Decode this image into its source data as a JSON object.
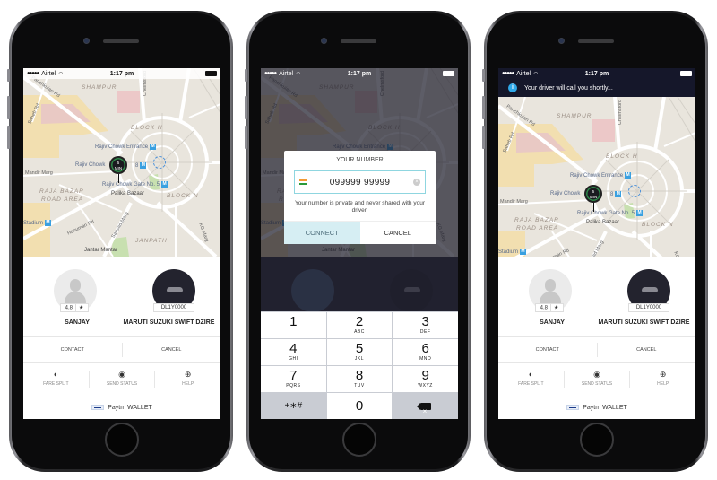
{
  "status_bar": {
    "carrier": "Airtel",
    "time": "1:17 pm"
  },
  "map": {
    "labels": {
      "shampur": "SHAMPUR",
      "block_h": "BLOCK H",
      "block_n": "BLOCK N",
      "raja_bazar_1": "RAJA BAZAR",
      "raja_bazar_2": "ROAD AREA",
      "janpath": "JANPATH",
      "rajiv_entrance": "Rajiv Chowk Entrance",
      "rajiv_chowk": "Rajiv Chowk",
      "rajiv_8": "8",
      "rajiv_gate5": "Rajiv Chowk Gate No. 5",
      "palika": "Palika Bazaar",
      "stadium": "Stadium",
      "mandir_marg": "Mandir Marg",
      "hanuman_rd": "Hanuman Rd",
      "sansad_marg": "Sansad Marg",
      "kg_marg": "KG Marg",
      "jantar_mantar": "Jantar Mantar",
      "chelmsford": "Chelmsford",
      "saheb_rd": "Saheb Rd",
      "panchkuian": "Panchkuian Rd"
    },
    "eta_pin": {
      "value": "5",
      "unit": "MIN"
    },
    "metro_glyph": "M"
  },
  "driver": {
    "name": "SANJAY",
    "rating": "4.8",
    "rating_icon": "★",
    "car": "MARUTI SUZUKI SWIFT DZIRE",
    "plate": "DL1Y0000"
  },
  "actions": {
    "contact": "CONTACT",
    "cancel": "CANCEL"
  },
  "tools": [
    {
      "label": "FARE SPLIT",
      "icon": "fare-split-icon",
      "glyph": "◐"
    },
    {
      "label": "SEND STATUS",
      "icon": "send-status-icon",
      "glyph": "◉"
    },
    {
      "label": "HELP",
      "icon": "help-icon",
      "glyph": "⊕"
    }
  ],
  "wallet": {
    "label": "Paytm WALLET"
  },
  "dialog": {
    "title": "YOUR NUMBER",
    "phone_value": "099999 99999",
    "clear_glyph": "×",
    "note": "Your number is private and never shared with your driver.",
    "connect": "CONNECT",
    "cancel": "CANCEL"
  },
  "keypad": [
    {
      "digit": "1",
      "letters": ""
    },
    {
      "digit": "2",
      "letters": "ABC"
    },
    {
      "digit": "3",
      "letters": "DEF"
    },
    {
      "digit": "4",
      "letters": "GHI"
    },
    {
      "digit": "5",
      "letters": "JKL"
    },
    {
      "digit": "6",
      "letters": "MNO"
    },
    {
      "digit": "7",
      "letters": "PQRS"
    },
    {
      "digit": "8",
      "letters": "TUV"
    },
    {
      "digit": "9",
      "letters": "WXYZ"
    },
    {
      "digit": "+∗#",
      "letters": ""
    },
    {
      "digit": "0",
      "letters": ""
    }
  ],
  "notification": {
    "icon_glyph": "i",
    "text": "Your driver will call you shortly..."
  }
}
